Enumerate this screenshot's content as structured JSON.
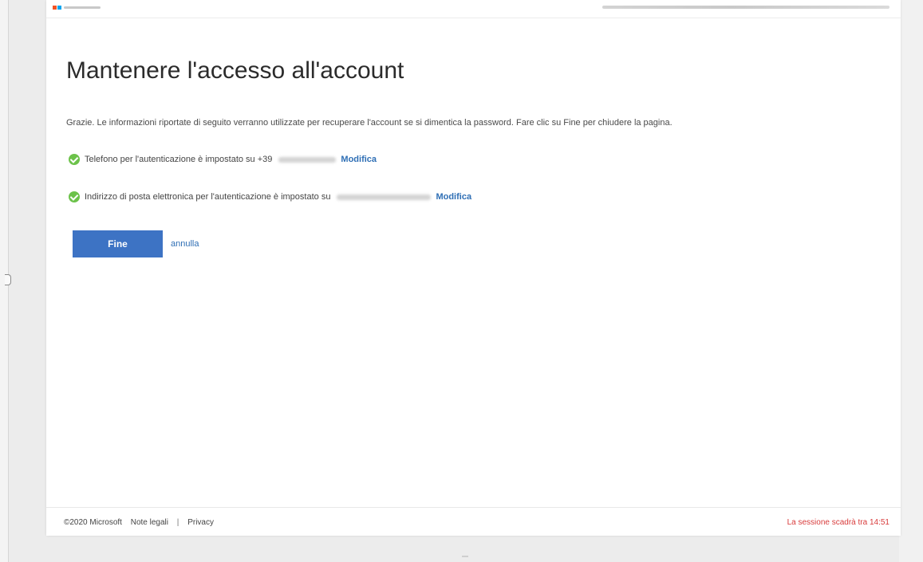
{
  "colors": {
    "accent": "#3d73c4",
    "link": "#2f6fb5",
    "success": "#6cc24a",
    "session_warning": "#d83b3b",
    "logo_squares": [
      "#f35325",
      "#81bc06",
      "#05a6f0",
      "#ffba08"
    ]
  },
  "page": {
    "title": "Mantenere l'accesso all'account",
    "intro": "Grazie. Le informazioni riportate di seguito verranno utilizzate per recuperare l'account se si dimentica la password. Fare clic su Fine per chiudere la pagina."
  },
  "phone_status": {
    "icon": "check-circle-icon",
    "text": "Telefono per l'autenticazione è impostato su +39",
    "edit_label": "Modifica"
  },
  "email_status": {
    "icon": "check-circle-icon",
    "text": "Indirizzo di posta elettronica per l'autenticazione è impostato su",
    "edit_label": "Modifica"
  },
  "actions": {
    "done_label": "Fine",
    "cancel_label": "annulla"
  },
  "footer": {
    "copyright": "©2020 Microsoft",
    "legal": "Note legali",
    "separator": "|",
    "privacy": "Privacy",
    "session": "La sessione scadrà tra 14:51"
  }
}
